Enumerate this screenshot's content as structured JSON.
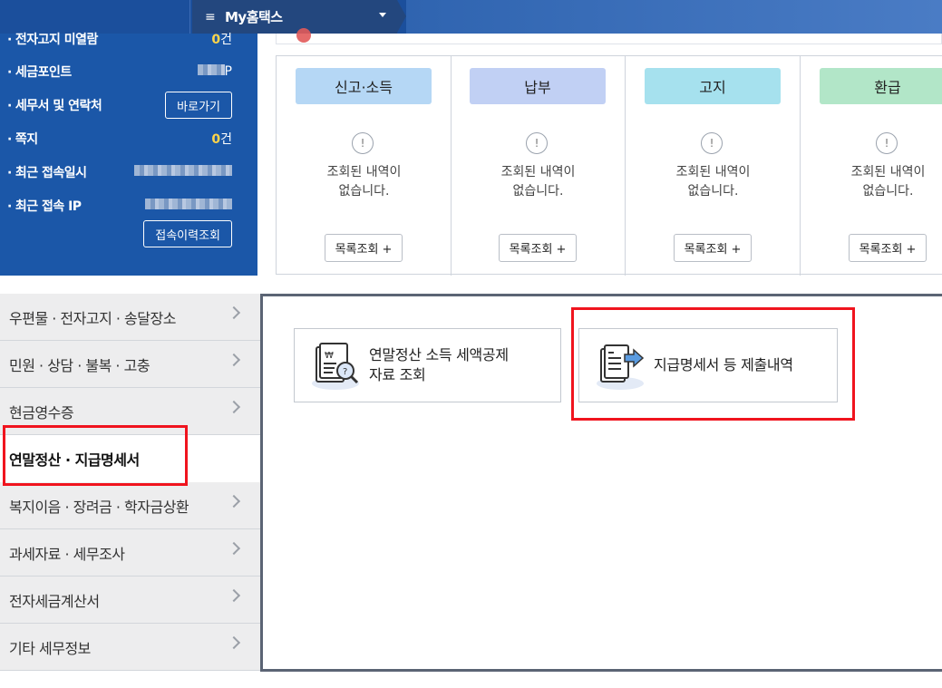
{
  "topbar": {
    "menu_label": "My홈택스"
  },
  "info": {
    "rows": [
      {
        "label": "전자고지 미열람",
        "num": "0",
        "unit": "건"
      },
      {
        "label": "세금포인트",
        "suffix": "P"
      },
      {
        "label": "세무서 및 연락처",
        "button": "바로가기"
      },
      {
        "label": "쪽지",
        "num": "0",
        "unit": "건"
      },
      {
        "label": "최근 접속일시"
      },
      {
        "label": "최근 접속 IP"
      }
    ],
    "history_button": "접속이력조회"
  },
  "cards": [
    {
      "title": "신고·소득",
      "color": "#b5d7f5",
      "msg": "조회된 내역이\n없습니다.",
      "button": "목록조회 +"
    },
    {
      "title": "납부",
      "color": "#c1d0f4",
      "msg": "조회된 내역이\n없습니다.",
      "button": "목록조회 +"
    },
    {
      "title": "고지",
      "color": "#a6e1ee",
      "msg": "조회된 내역이\n없습니다.",
      "button": "목록조회 +"
    },
    {
      "title": "환급",
      "color": "#b2e6c8",
      "msg": "조회된 내역이\n없습니다.",
      "button": "목록조회 +"
    }
  ],
  "nav": [
    {
      "label": "우편물 · 전자고지 · 송달장소"
    },
    {
      "label": "민원 · 상담 · 불복 · 고충"
    },
    {
      "label": "현금영수증"
    },
    {
      "label": "연말정산 · 지급명세서",
      "active": true
    },
    {
      "label": "복지이음 · 장려금 · 학자금상환"
    },
    {
      "label": "과세자료 · 세무조사"
    },
    {
      "label": "전자세금계산서"
    },
    {
      "label": "기타 세무정보"
    }
  ],
  "services": [
    {
      "label": "연말정산 소득 세액공제\n자료 조회",
      "icon": "tax-deduction-search-icon"
    },
    {
      "label": "지급명세서 등 제출내역",
      "icon": "payment-statement-submit-icon"
    }
  ],
  "colors": {
    "header": "#1b4f9c",
    "panel": "#1b57a8",
    "highlight": "#f0141e",
    "accent_num": "#ffd54a"
  }
}
